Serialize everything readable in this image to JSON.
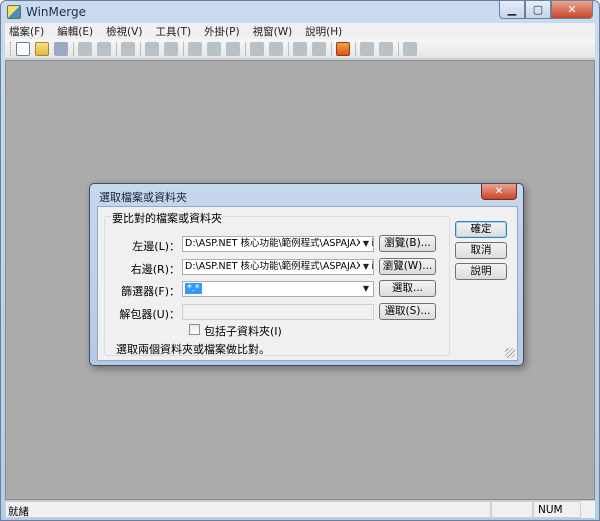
{
  "window": {
    "title": "WinMerge"
  },
  "menu": [
    "檔案(F)",
    "編輯(E)",
    "檢視(V)",
    "工具(T)",
    "外掛(P)",
    "視窗(W)",
    "說明(H)"
  ],
  "status": {
    "text": "就緒",
    "num": "NUM"
  },
  "dialog": {
    "title": "選取檔案或資料夾",
    "group_label": "要比對的檔案或資料夾",
    "left": {
      "label": "左邊(L)：",
      "value": "D:\\ASP.NET 核心功能\\範例程式\\ASPAJAX\\Tim",
      "button": "瀏覽(B)..."
    },
    "right": {
      "label": "右邊(R)：",
      "value": "D:\\ASP.NET 核心功能\\範例程式\\ASPAJAX\\Tim",
      "button": "瀏覽(W)..."
    },
    "filter": {
      "label": "篩選器(F)：",
      "value": "*.*",
      "button": "選取..."
    },
    "unpacker": {
      "label": "解包器(U)：",
      "value": "",
      "button": "選取(S)..."
    },
    "include_subfolders": {
      "label": "包括子資料夾(I)",
      "checked": false
    },
    "hint": "選取兩個資料夾或檔案做比對。",
    "ok_button": "確定",
    "cancel_button": "取消",
    "help_button": "說明"
  },
  "icons": {
    "app": "winmerge-icon",
    "toolbar": [
      "new-icon",
      "open-icon",
      "save-icon",
      "undo-icon",
      "redo-icon",
      "...",
      "options-icon"
    ]
  }
}
